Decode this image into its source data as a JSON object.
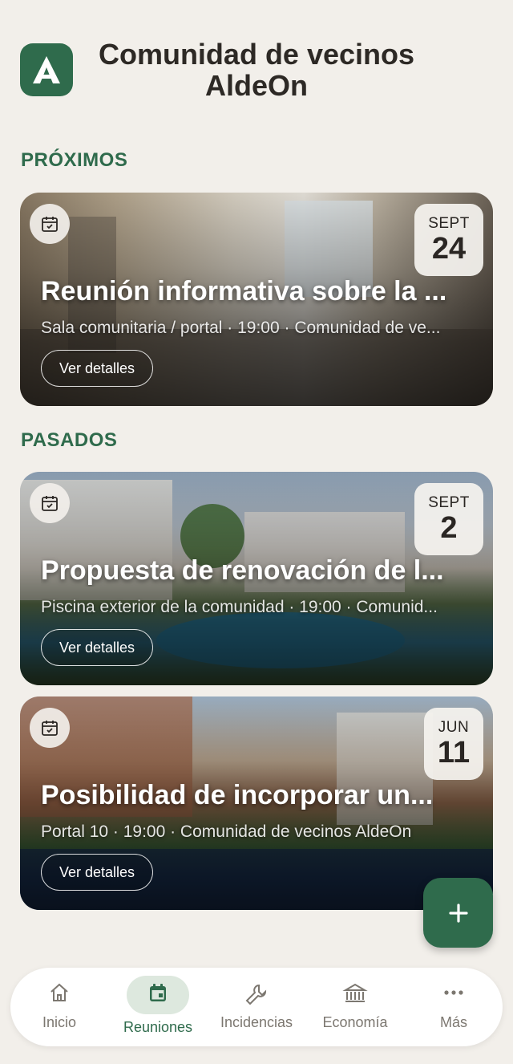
{
  "app": {
    "logo_letter": "A",
    "title": "Comunidad de vecinos AldeOn"
  },
  "sections": {
    "upcoming": "PRÓXIMOS",
    "past": "PASADOS"
  },
  "meetings": [
    {
      "title": "Reunión informativa sobre la ...",
      "meta": "Sala comunitaria / portal · 19:00 · Comunidad de ve...",
      "month": "SEPT",
      "day": "24",
      "button": "Ver detalles",
      "icon": "calendar-check-icon"
    },
    {
      "title": "Propuesta de renovación de l...",
      "meta": "Piscina exterior de la comunidad · 19:00 · Comunid...",
      "month": "SEPT",
      "day": "2",
      "button": "Ver detalles",
      "icon": "calendar-check-icon"
    },
    {
      "title": "Posibilidad de incorporar un...",
      "meta": "Portal 10 · 19:00 · Comunidad de vecinos AldeOn",
      "month": "JUN",
      "day": "11",
      "button": "Ver detalles",
      "icon": "calendar-check-icon"
    }
  ],
  "fab": {
    "label": "+",
    "icon": "plus-icon"
  },
  "nav": [
    {
      "label": "Inicio",
      "icon": "home-icon",
      "active": false
    },
    {
      "label": "Reuniones",
      "icon": "calendar-icon",
      "active": true
    },
    {
      "label": "Incidencias",
      "icon": "wrench-icon",
      "active": false
    },
    {
      "label": "Economía",
      "icon": "bank-icon",
      "active": false
    },
    {
      "label": "Más",
      "icon": "more-dots-icon",
      "active": false
    }
  ],
  "colors": {
    "brand": "#2f6b4c",
    "background": "#f2efea",
    "nav_active_pill": "#dde8de"
  }
}
